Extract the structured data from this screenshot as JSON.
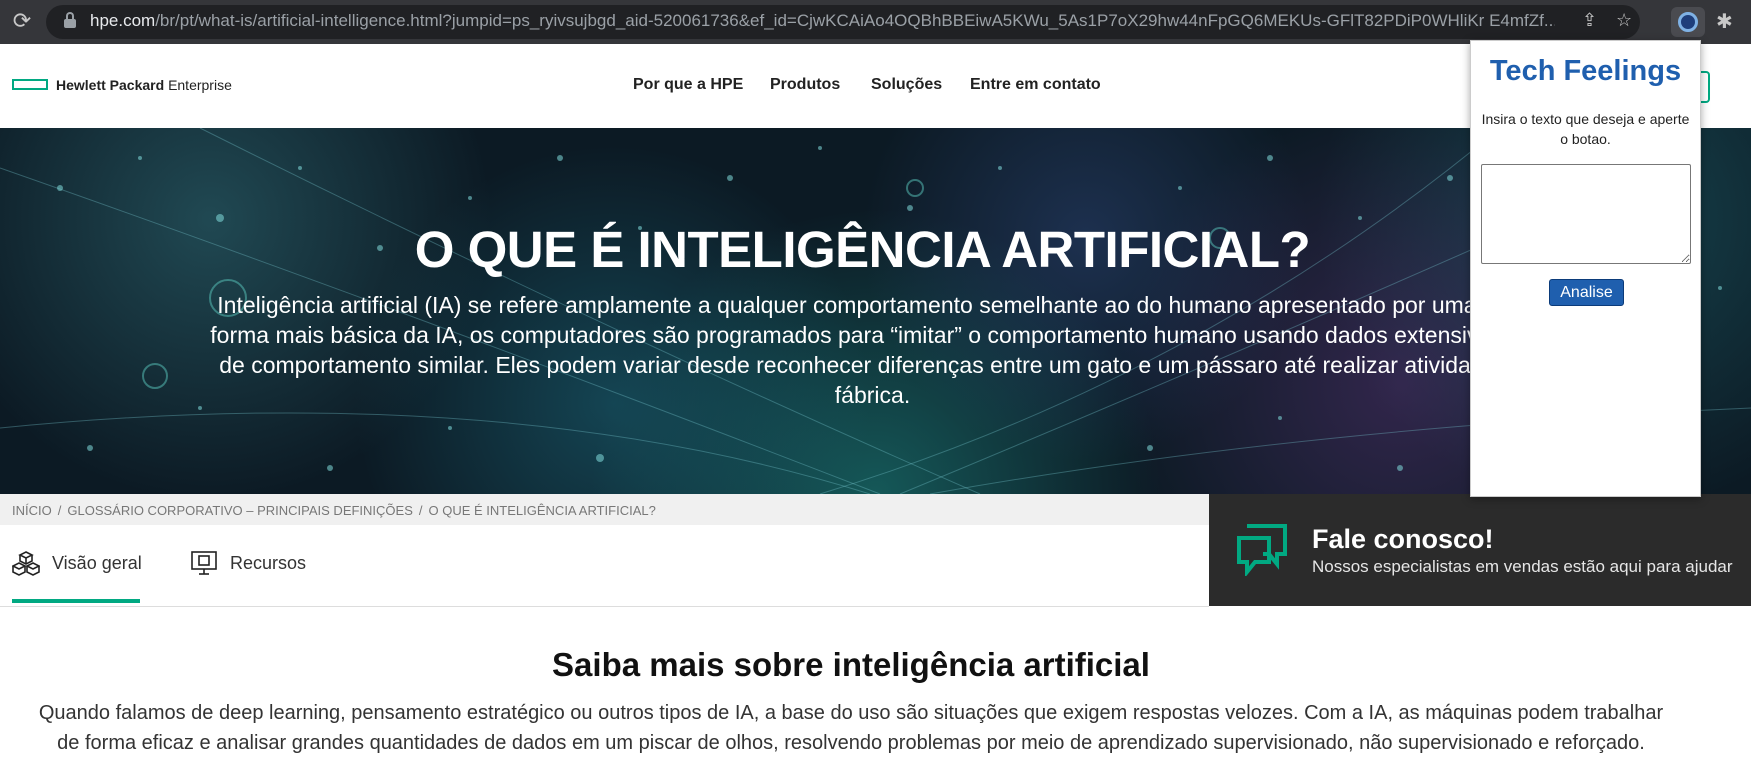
{
  "browser": {
    "url_host": "hpe.com",
    "url_rest": "/br/pt/what-is/artificial-intelligence.html?jumpid=ps_ryivsujbgd_aid-520061736&ef_id=CjwKCAiAo4OQBhBBEiwA5KWu_5As1P7oX29hw44nFpGQ6MEKUs-GFlT82PDiP0WHliKr E4mfZf..."
  },
  "site": {
    "logo_bold": "Hewlett Packard",
    "logo_light": "Enterprise",
    "nav": [
      "Por que a HPE",
      "Produtos",
      "Soluções",
      "Entre em contato"
    ]
  },
  "hero": {
    "title": "O QUE É INTELIGÊNCIA ARTIFICIAL?",
    "lines": [
      "Inteligência artificial (IA) se refere amplamente a qualquer comportamento semelhante ao do humano apresentado por uma máq",
      "forma mais básica da IA, os computadores são programados para “imitar” o comportamento humano usando dados extensivos de",
      "de comportamento similar. Eles podem variar desde reconhecer diferenças entre um gato e um pássaro até realizar atividades c",
      "fábrica."
    ]
  },
  "breadcrumb": [
    "INÍCIO",
    "GLOSSÁRIO CORPORATIVO – PRINCIPAIS DEFINIÇÕES",
    "O QUE É INTELIGÊNCIA ARTIFICIAL?"
  ],
  "breadcrumb_sep": "/",
  "tabs": [
    {
      "label": "Visão geral",
      "icon": "cubes-icon",
      "active": true
    },
    {
      "label": "Recursos",
      "icon": "presentation-icon",
      "active": false
    }
  ],
  "contact": {
    "title": "Fale conosco!",
    "subtitle": "Nossos especialistas em vendas estão aqui para ajudar",
    "icon": "chat-bubbles-icon"
  },
  "section": {
    "title": "Saiba mais sobre inteligência artificial",
    "lines": [
      "Quando falamos de deep learning, pensamento estratégico ou outros tipos de IA, a base do uso são situações que exigem respostas velozes. Com a IA, as máquinas podem trabalhar",
      "de forma eficaz e analisar grandes quantidades de dados em um piscar de olhos, resolvendo problemas por meio de aprendizado supervisionado, não supervisionado e reforçado."
    ]
  },
  "popup": {
    "title": "Tech Feelings",
    "instruction": "Insira o texto que deseja e aperte o botao.",
    "textarea_value": "",
    "button_label": "Analise"
  },
  "colors": {
    "hpe_green": "#01a982",
    "popup_blue": "#1f5fae",
    "chrome_dark": "#35363a"
  }
}
